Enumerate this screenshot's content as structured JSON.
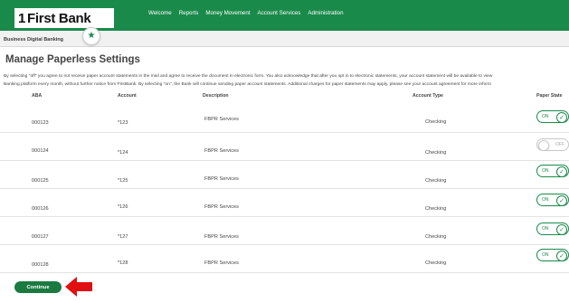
{
  "brand": {
    "logo_text_one": "1",
    "logo_text_rest": "First Bank"
  },
  "nav": {
    "items": [
      "Welcome",
      "Reports",
      "Money Movement",
      "Account Services",
      "Administration"
    ]
  },
  "subheader": {
    "title": "Business Digital Banking"
  },
  "page": {
    "title": "Manage Paperless Settings",
    "description_line1": "By selecting \"off\" you agree to not receive paper account statements in the mail and agree to receive the document in electronic form. You also acknowledge that after you opt in to electronic statements, your account statement will be available to view",
    "description_line2": "Banking platform every month, without further notice from FirstBank. By selecting \"on\", the Bank will continue sending paper account statements. Additional charges for paper statements may apply, please see your account agreement for more inform"
  },
  "table": {
    "headers": {
      "aba": "ABA",
      "account": "Account",
      "description": "Description",
      "account_type": "Account Type",
      "paper_statements": "Paper State"
    },
    "rows": [
      {
        "aba": "000123",
        "account": "*123",
        "description": "FBPR Services",
        "account_type": "Checking",
        "toggle_label": "ON",
        "toggle_on": true
      },
      {
        "aba": "000124",
        "account": "*124",
        "description": "FBPR Services",
        "account_type": "Checking",
        "toggle_label": "OFF",
        "toggle_on": false
      },
      {
        "aba": "000125",
        "account": "*125",
        "description": "FBPR Services",
        "account_type": "Checking",
        "toggle_label": "ON",
        "toggle_on": true
      },
      {
        "aba": "000126",
        "account": "*126",
        "description": "FBPR Services",
        "account_type": "Checking",
        "toggle_label": "ON",
        "toggle_on": true
      },
      {
        "aba": "000127",
        "account": "*127",
        "description": "FBPR Services",
        "account_type": "Checking",
        "toggle_label": "ON",
        "toggle_on": true
      },
      {
        "aba": "000128",
        "account": "*128",
        "description": "FBPR Services",
        "account_type": "Checking",
        "toggle_label": "ON",
        "toggle_on": true
      }
    ]
  },
  "actions": {
    "continue_label": "Continue"
  },
  "icons": {
    "star": "star-icon",
    "check": "check-icon",
    "arrow": "red-arrow-icon"
  },
  "colors": {
    "brand_green": "#1a8a4a",
    "button_green": "#1a7a40",
    "arrow_red": "#e01010"
  }
}
